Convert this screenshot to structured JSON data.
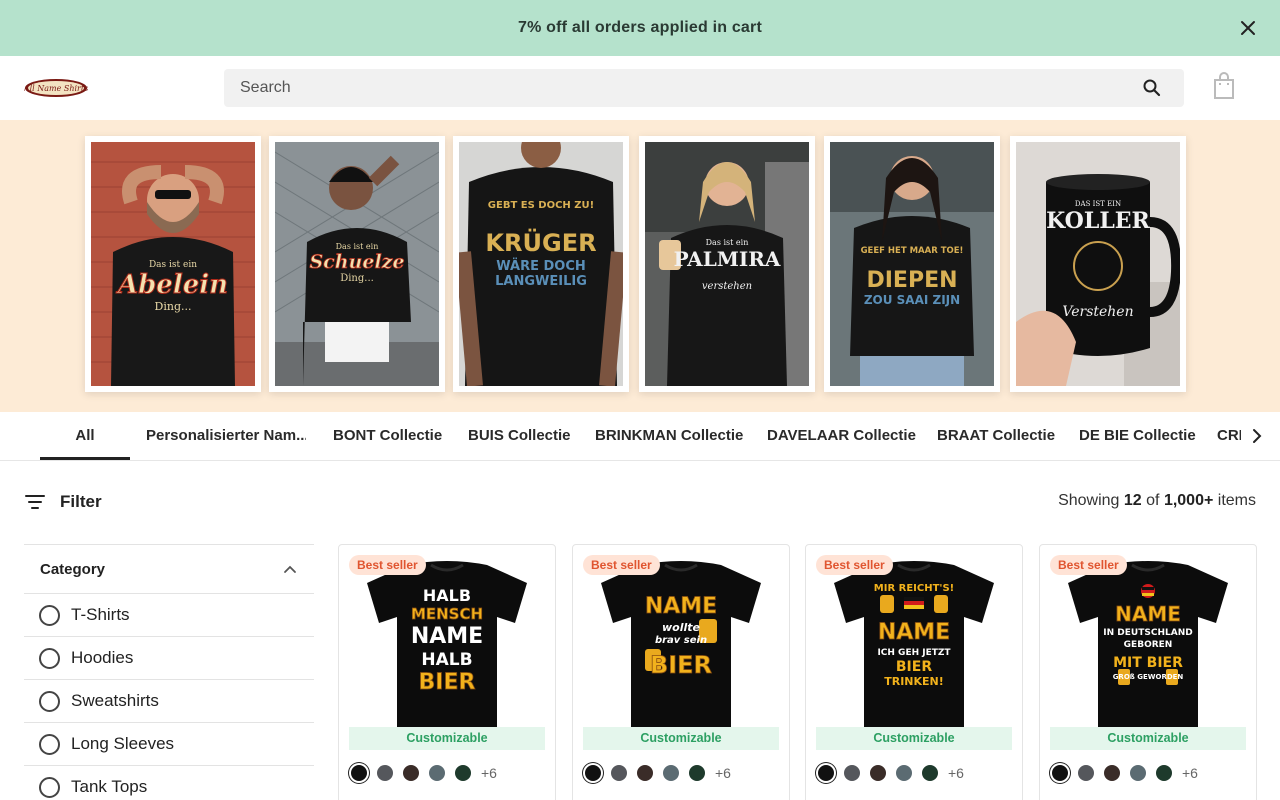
{
  "announcement": {
    "text": "7% off all orders applied in cart"
  },
  "header": {
    "logo_text": "All Name Shirts",
    "search_placeholder": "Search"
  },
  "banner": {
    "photos": [
      {
        "name": "Abelein",
        "line1": "Das ist ein",
        "line2": "Ding..."
      },
      {
        "name": "Schuelze",
        "line1": "Das ist ein",
        "line2": "Ding..."
      },
      {
        "name": "KRÜGER",
        "line1": "GEBT ES DOCH ZU!",
        "line2": "WÄRE DOCH LANGWEILIG"
      },
      {
        "name": "PALMIRA",
        "line1": "Das ist ein",
        "line2": "verstehen"
      },
      {
        "name": "DIEPEN",
        "line1": "GEEF HET MAAR TOE!",
        "line2": "ZOU SAAI ZIJN"
      },
      {
        "name": "KOLLER",
        "line1": "DAS IST EIN",
        "line2": "Verstehen"
      }
    ]
  },
  "tabs": [
    {
      "label": "All"
    },
    {
      "label": "Personalisierter Nam..."
    },
    {
      "label": "BONT Collectie"
    },
    {
      "label": "BUIS Collectie"
    },
    {
      "label": "BRINKMAN Collectie"
    },
    {
      "label": "DAVELAAR Collectie"
    },
    {
      "label": "BRAAT Collectie"
    },
    {
      "label": "DE BIE Collectie"
    },
    {
      "label": "CRI"
    }
  ],
  "filter": {
    "label": "Filter",
    "showing_prefix": "Showing ",
    "showing_count": "12",
    "showing_mid": " of ",
    "showing_total": "1,000+",
    "showing_suffix": " items"
  },
  "sidebar": {
    "category_title": "Category",
    "items": [
      {
        "label": "T-Shirts"
      },
      {
        "label": "Hoodies"
      },
      {
        "label": "Sweatshirts"
      },
      {
        "label": "Long Sleeves"
      },
      {
        "label": "Tank Tops"
      }
    ]
  },
  "products": [
    {
      "badge": "Best seller",
      "customizable": "Customizable",
      "more_colors": "+6",
      "print_lines": [
        "HALB",
        "MENSCH",
        "NAME",
        "HALB",
        "BIER"
      ]
    },
    {
      "badge": "Best seller",
      "customizable": "Customizable",
      "more_colors": "+6",
      "print_lines": [
        "NAME",
        "wollte",
        "brav sein",
        "BIER"
      ]
    },
    {
      "badge": "Best seller",
      "customizable": "Customizable",
      "more_colors": "+6",
      "print_lines": [
        "MIR REICHT'S!",
        "NAME",
        "ICH GEH JETZT",
        "BIER",
        "TRINKEN!"
      ]
    },
    {
      "badge": "Best seller",
      "customizable": "Customizable",
      "more_colors": "+6",
      "print_lines": [
        "NAME",
        "IN DEUTSCHLAND",
        "GEBOREN",
        "MIT BIER",
        "GROß GEWORDEN"
      ]
    }
  ],
  "swatch_colors": [
    "#111111",
    "#55575c",
    "#3a2c28",
    "#5b6b72",
    "#1e3a2c"
  ],
  "colors": {
    "accent_green": "#b5e2cc",
    "badge_text": "#e05530",
    "custom_text": "#2da063",
    "banner_bg": "#fdebd6"
  }
}
